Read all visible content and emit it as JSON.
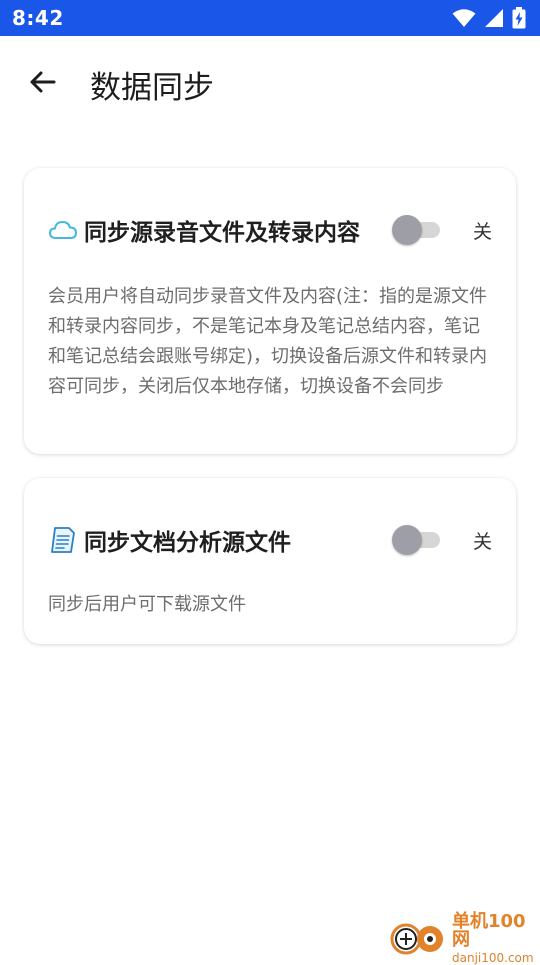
{
  "status_bar": {
    "time": "8:42",
    "icons": [
      "wifi-icon",
      "signal-icon",
      "battery-charging-icon"
    ]
  },
  "header": {
    "back_icon": "arrow-left-icon",
    "title": "数据同步"
  },
  "cards": [
    {
      "icon": "cloud-icon",
      "title": "同步源录音文件及转录内容",
      "toggle_on": false,
      "state_label": "关",
      "description": "会员用户将自动同步录音文件及内容(注：指的是源文件和转录内容同步，不是笔记本身及笔记总结内容，笔记和笔记总结会跟账号绑定)，切换设备后源文件和转录内容可同步，关闭后仅本地存储，切换设备不会同步"
    },
    {
      "icon": "document-icon",
      "title": "同步文档分析源文件",
      "toggle_on": false,
      "state_label": "关",
      "description": "同步后用户可下载源文件"
    }
  ],
  "watermark": {
    "name": "单机100网",
    "url": "danji100.com"
  },
  "colors": {
    "status_bar": "#1a56e8",
    "toggle_thumb_off": "#9e9ea6",
    "toggle_track_off": "#d6d6d6",
    "cloud_icon": "#45b7e0",
    "document_icon": "#2a7fc7"
  }
}
